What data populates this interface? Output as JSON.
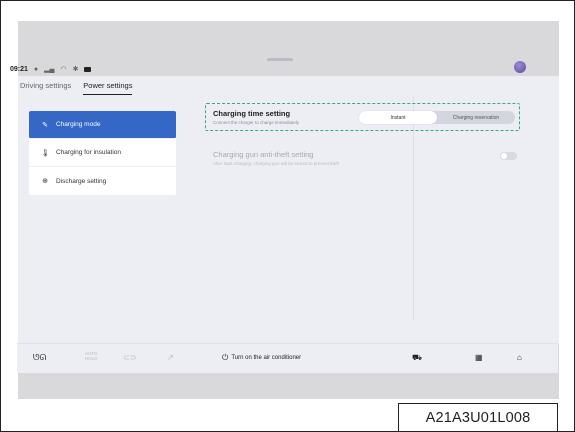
{
  "status_bar": {
    "time": "09:21"
  },
  "tabs": [
    {
      "label": "Driving settings",
      "active": false
    },
    {
      "label": "Power settings",
      "active": true
    }
  ],
  "sidebar": {
    "items": [
      {
        "label": "Charging mode",
        "icon": "plug-icon",
        "active": true
      },
      {
        "label": "Charging for insulation",
        "icon": "thermometer-icon",
        "active": false
      },
      {
        "label": "Discharge setting",
        "icon": "discharge-icon",
        "active": false
      }
    ]
  },
  "content": {
    "charging_time": {
      "title": "Charging time setting",
      "subtitle": "Connect the charger to charge immediately",
      "options": [
        {
          "label": "Instant",
          "selected": true
        },
        {
          "label": "Charging reservation",
          "selected": false
        }
      ]
    },
    "anti_theft": {
      "title": "Charging gun anti-theft setting",
      "subtitle": "After start charging, charging gun will be locked to prevent theft",
      "enabled": false
    }
  },
  "dock": {
    "climate_label": "Turn on the air conditioner",
    "auto_label_1": "AUTO",
    "auto_label_2": "HOLD"
  },
  "figure_code": "A21A3U01L008",
  "colors": {
    "accent": "#3568c6",
    "highlight_border": "#37a88a",
    "panel_bg": "#eceef4"
  }
}
